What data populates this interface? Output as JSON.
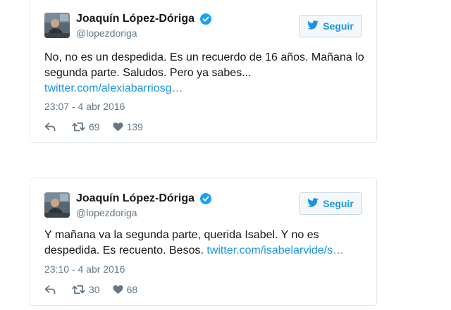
{
  "tweets": [
    {
      "author": {
        "name": "Joaquín López-Dóriga",
        "handle": "@lopezdoriga",
        "verified": true
      },
      "follow_label": "Seguir",
      "text": "No, no es un despedida. Es un recuerdo de 16 años. Mañana lo segunda parte. Saludos. Pero ya sabes... ",
      "link": "twitter.com/alexiabarriosg…",
      "timestamp": "23:07 - 4 abr 2016",
      "retweets": "69",
      "likes": "139"
    },
    {
      "author": {
        "name": "Joaquín López-Dóriga",
        "handle": "@lopezdoriga",
        "verified": true
      },
      "follow_label": "Seguir",
      "text": "Y mañana va la segunda parte, querida Isabel. Y no es despedida. Es recuento. Besos. ",
      "link": "twitter.com/isabelarvide/s…",
      "timestamp": "23:10 - 4 abr 2016",
      "retweets": "30",
      "likes": "68"
    }
  ],
  "icons": {
    "verified": "verified-badge-icon",
    "follow": "twitter-bird-icon",
    "reply": "reply-icon",
    "retweet": "retweet-icon",
    "like": "heart-icon"
  },
  "colors": {
    "accent": "#1b95e0",
    "text": "#14171a",
    "muted": "#657786",
    "border": "#e1e8ed"
  }
}
